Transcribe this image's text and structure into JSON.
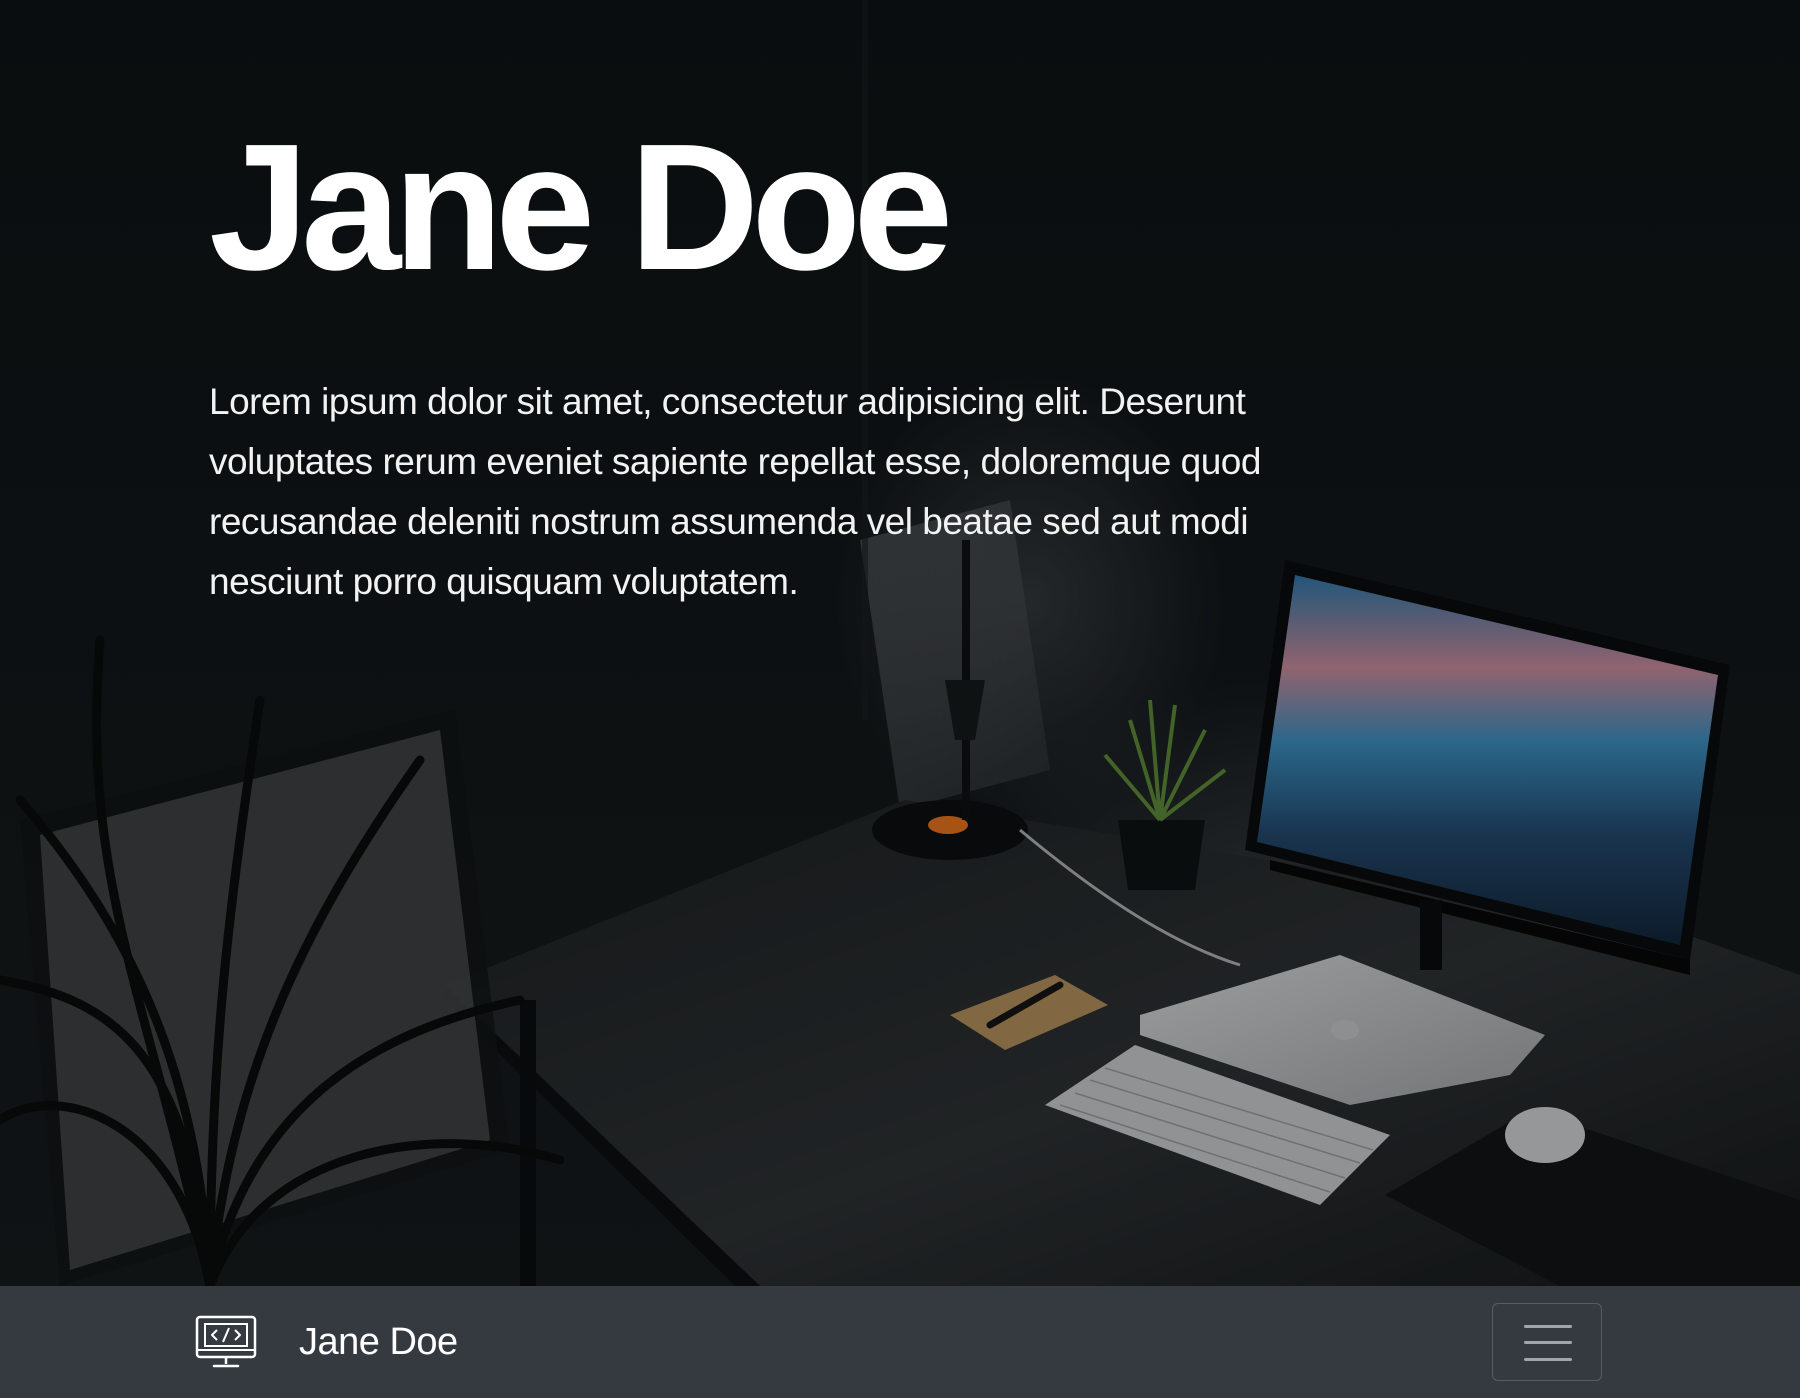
{
  "hero": {
    "title": "Jane Doe",
    "lead": "Lorem ipsum dolor sit amet, consectetur adipisicing elit. Deserunt voluptates rerum eveniet sapiente repellat esse, doloremque quod recusandae deleniti nostrum assumenda vel beatae sed aut modi nesciunt porro quisquam voluptatem.",
    "background_image": "dark desk setup with monitor, laptop, keyboard, lamp and plants"
  },
  "navbar": {
    "brand_icon": "monitor-code-icon",
    "brand_text": "Jane Doe",
    "toggler_icon": "hamburger-menu-icon"
  },
  "colors": {
    "navbar_background": "#343a40",
    "hero_text": "#ffffff"
  }
}
